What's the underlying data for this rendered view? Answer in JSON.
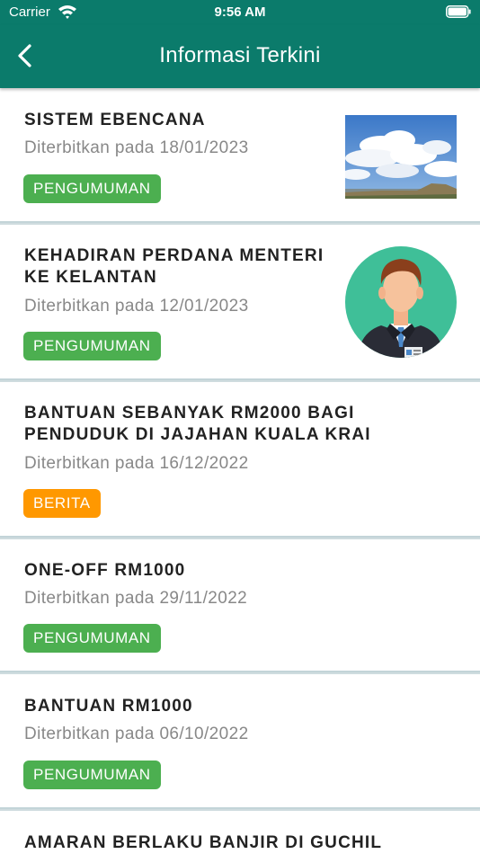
{
  "status_bar": {
    "carrier": "Carrier",
    "time": "9:56 AM"
  },
  "header": {
    "title": "Informasi Terkini"
  },
  "colors": {
    "primary": "#0b7b6b",
    "badge_pengumuman": "#4caf50",
    "badge_berita": "#ff9800"
  },
  "items": [
    {
      "title": "SISTEM EBENCANA",
      "date": "Diterbitkan pada 18/01/2023",
      "category": "PENGUMUMAN",
      "thumbnail": "sky-photo"
    },
    {
      "title": "KEHADIRAN PERDANA MENTERI KE KELANTAN",
      "date": "Diterbitkan pada 12/01/2023",
      "category": "PENGUMUMAN",
      "thumbnail": "person-avatar"
    },
    {
      "title": "BANTUAN SEBANYAK RM2000 BAGI PENDUDUK DI JAJAHAN KUALA KRAI",
      "date": "Diterbitkan pada 16/12/2022",
      "category": "BERITA"
    },
    {
      "title": "ONE-OFF RM1000",
      "date": "Diterbitkan pada 29/11/2022",
      "category": "PENGUMUMAN"
    },
    {
      "title": "BANTUAN RM1000",
      "date": "Diterbitkan pada 06/10/2022",
      "category": "PENGUMUMAN"
    },
    {
      "title": "AMARAN BERLAKU BANJIR DI GUCHIL"
    }
  ]
}
